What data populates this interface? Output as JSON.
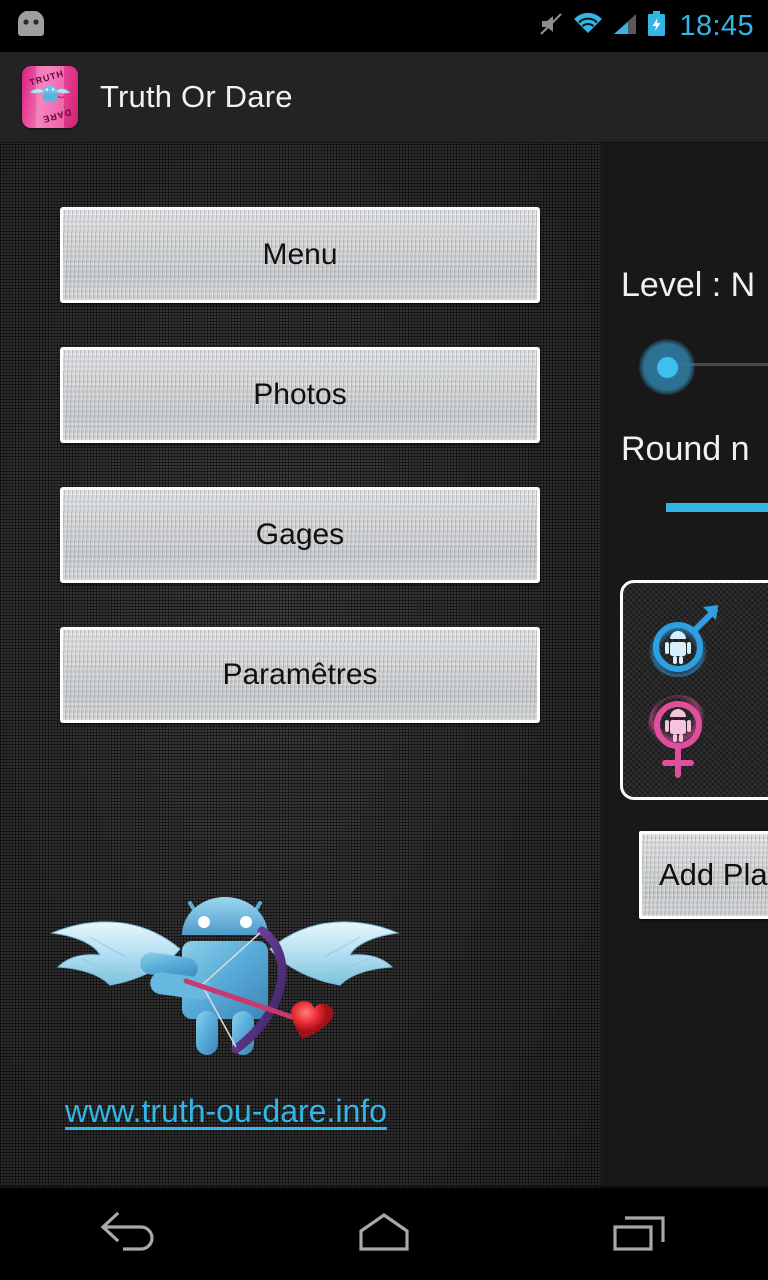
{
  "status_bar": {
    "notification_icon": "android-head-icon",
    "mute_icon": "volume-muted-icon",
    "wifi_icon": "wifi-icon",
    "signal_icon": "cellular-signal-icon",
    "battery_icon": "battery-charging-icon",
    "clock": "18:45",
    "accent_color": "#33b5e5"
  },
  "action_bar": {
    "app_icon": "truth-or-dare-app-icon",
    "icon_word_top": "TRUTH",
    "icon_word_bottom": "DARE",
    "title": "Truth Or Dare",
    "background_color": "#232323"
  },
  "left_panel": {
    "buttons": [
      {
        "id": "menu",
        "label": "Menu"
      },
      {
        "id": "photos",
        "label": "Photos"
      },
      {
        "id": "gages",
        "label": "Gages"
      },
      {
        "id": "parametres",
        "label": "Paramêtres"
      }
    ],
    "mascot_icon": "cupid-android-mascot",
    "website_link": "www.truth-ou-dare.info",
    "link_color": "#33b5e5"
  },
  "right_panel": {
    "level_label": "Level : N",
    "level_slider": {
      "name": "level-slider",
      "thumb_position_percent": 0,
      "thumb_color": "#3bc0ef",
      "track_color": "#4a4a4a"
    },
    "round_label": "Round n",
    "round_input": {
      "value": "",
      "underline_color": "#33b5e5"
    },
    "player_genders": [
      {
        "id": "male",
        "icon": "male-android-icon",
        "color": "#2e9fe0"
      },
      {
        "id": "female",
        "icon": "female-android-icon",
        "color": "#e04f9e"
      }
    ],
    "add_player_label": "Add Pla"
  },
  "nav_bar": {
    "back": "back-icon",
    "home": "home-icon",
    "recents": "recent-apps-icon"
  }
}
